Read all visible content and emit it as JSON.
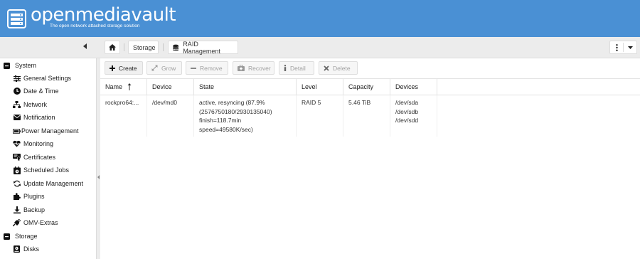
{
  "app": {
    "title": "openmediavault",
    "tagline": "The open network attached storage solution",
    "header_color": "#4a90d4"
  },
  "breadcrumb": {
    "home_icon": "home-icon",
    "items": [
      {
        "label": "Storage"
      },
      {
        "label": "RAID Management",
        "icon": "database-icon"
      }
    ]
  },
  "top_actions": {
    "menu_icon": "vertical-dots-icon",
    "dropdown_icon": "caret-down-icon"
  },
  "sidebar": {
    "groups": [
      {
        "label": "System",
        "items": [
          {
            "label": "General Settings",
            "icon": "sliders-icon"
          },
          {
            "label": "Date & Time",
            "icon": "clock-icon"
          },
          {
            "label": "Network",
            "icon": "network-icon"
          },
          {
            "label": "Notification",
            "icon": "envelope-icon"
          },
          {
            "label": "Power Management",
            "icon": "battery-icon"
          },
          {
            "label": "Monitoring",
            "icon": "heartbeat-icon"
          },
          {
            "label": "Certificates",
            "icon": "certificate-icon"
          },
          {
            "label": "Scheduled Jobs",
            "icon": "calendar-icon"
          },
          {
            "label": "Update Management",
            "icon": "refresh-icon"
          },
          {
            "label": "Plugins",
            "icon": "puzzle-icon"
          },
          {
            "label": "Backup",
            "icon": "download-icon"
          },
          {
            "label": "OMV-Extras",
            "icon": "plug-icon"
          }
        ]
      },
      {
        "label": "Storage",
        "items": [
          {
            "label": "Disks",
            "icon": "disk-icon"
          }
        ]
      }
    ]
  },
  "grid_toolbar": {
    "create": "Create",
    "grow": "Grow",
    "remove": "Remove",
    "recover": "Recover",
    "detail": "Detail",
    "delete": "Delete"
  },
  "table": {
    "columns": [
      "Name",
      "Device",
      "State",
      "Level",
      "Capacity",
      "Devices"
    ],
    "sort_indicator": "sort-asc-icon",
    "rows": [
      {
        "name": "rockpro64:...",
        "device": "/dev/md0",
        "state": [
          "active, resyncing (87.9%",
          "(2576750180/2930135040)",
          "finish=118.7min",
          "speed=49580K/sec)"
        ],
        "level": "RAID 5",
        "capacity": "5.46 TiB",
        "devices": [
          "/dev/sda",
          "/dev/sdb",
          "/dev/sdd"
        ]
      }
    ]
  }
}
